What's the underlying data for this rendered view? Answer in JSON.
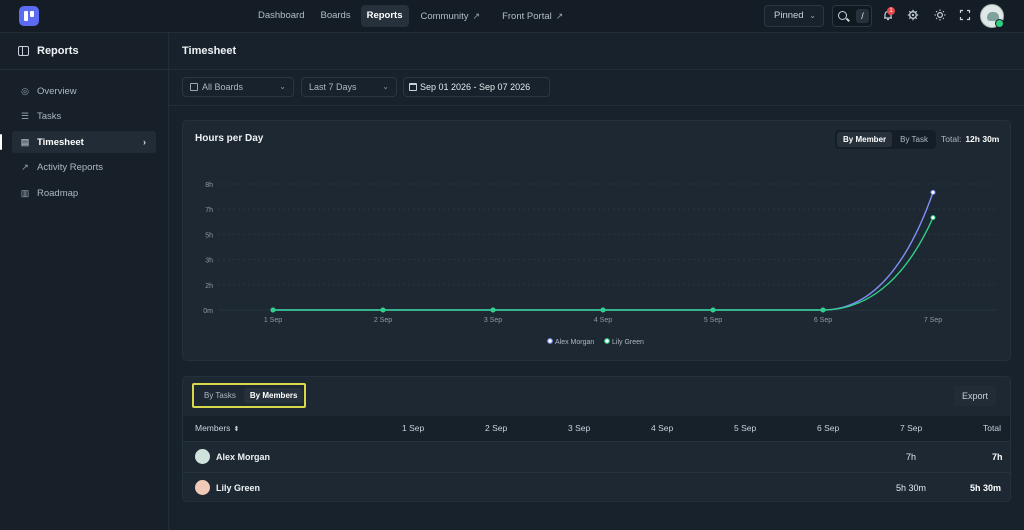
{
  "topnav": {
    "items": [
      {
        "label": "Dashboard",
        "active": false,
        "external": false
      },
      {
        "label": "Boards",
        "active": false,
        "external": false
      },
      {
        "label": "Reports",
        "active": true,
        "external": false
      },
      {
        "label": "Community",
        "active": false,
        "external": true
      },
      {
        "label": "Front Portal",
        "active": false,
        "external": true
      }
    ],
    "external_glyph": "↗",
    "pinned_label": "Pinned",
    "search_shortcut": "/",
    "notification_count": "1",
    "icons": [
      "search-icon",
      "bell-icon",
      "gear-icon",
      "sun-icon",
      "fullscreen-icon",
      "user-avatar"
    ]
  },
  "sidebar": {
    "title": "Reports",
    "items": [
      {
        "label": "Overview",
        "icon": "◎",
        "active": false
      },
      {
        "label": "Tasks",
        "icon": "☰",
        "active": false
      },
      {
        "label": "Timesheet",
        "icon": "▤",
        "active": true
      },
      {
        "label": "Activity Reports",
        "icon": "↗",
        "active": false
      },
      {
        "label": "Roadmap",
        "icon": "▥",
        "active": false
      }
    ],
    "active_arrow": "›"
  },
  "page": {
    "title": "Timesheet"
  },
  "filters": {
    "boards": "All Boards",
    "period": "Last 7 Days",
    "date_range": "Sep 01 2026 - Sep 07 2026"
  },
  "chart_card": {
    "title": "Hours per Day",
    "toggle": [
      "By Member",
      "By Task"
    ],
    "toggle_active": 0,
    "total_label": "Total:",
    "total_value": "12h 30m"
  },
  "chart_data": {
    "type": "line",
    "title": "Hours per Day",
    "categories": [
      "1 Sep",
      "2 Sep",
      "3 Sep",
      "4 Sep",
      "5 Sep",
      "6 Sep",
      "7 Sep"
    ],
    "y_ticks": [
      "0m",
      "2h",
      "3h",
      "5h",
      "7h",
      "8h"
    ],
    "y_tick_values": [
      0,
      1.5,
      3,
      4.5,
      6,
      7.5
    ],
    "ylim": [
      0,
      7.5
    ],
    "grid": true,
    "legend_position": "bottom-center",
    "series": [
      {
        "name": "Alex Morgan",
        "color": "#7f8ff5",
        "values": [
          0,
          0,
          0,
          0,
          0,
          0,
          7
        ]
      },
      {
        "name": "Lily Green",
        "color": "#2fd08a",
        "values": [
          0,
          0,
          0,
          0,
          0,
          0,
          5.5
        ]
      }
    ]
  },
  "table": {
    "tabs": [
      "By Tasks",
      "By Members"
    ],
    "tab_active": 1,
    "export_label": "Export",
    "columns": [
      "Members",
      "1 Sep",
      "2 Sep",
      "3 Sep",
      "4 Sep",
      "5 Sep",
      "6 Sep",
      "7 Sep",
      "Total"
    ],
    "sort_glyph": "⬍",
    "rows": [
      {
        "name": "Alex Morgan",
        "avatar_color": "#cfe3dc",
        "days": [
          "",
          "",
          "",
          "",
          "",
          "",
          "7h"
        ],
        "total": "7h"
      },
      {
        "name": "Lily Green",
        "avatar_color": "#f0c9b8",
        "days": [
          "",
          "",
          "",
          "",
          "",
          "",
          "5h 30m"
        ],
        "total": "5h 30m"
      }
    ]
  }
}
